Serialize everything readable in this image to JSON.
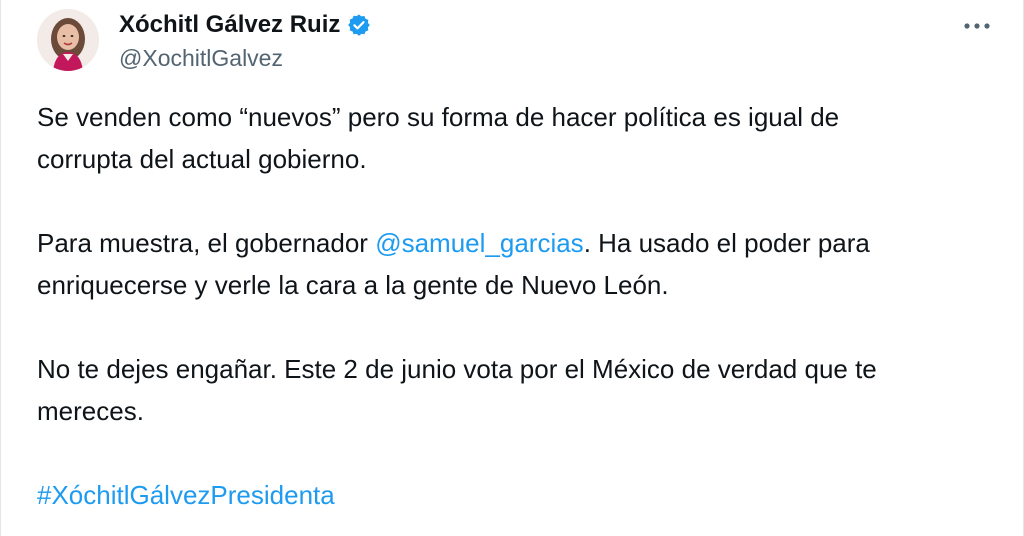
{
  "author": {
    "display_name": "Xóchitl Gálvez Ruiz",
    "handle": "@XochitlGalvez",
    "avatar_icon": "profile-photo",
    "verified_icon": "verified-badge-icon",
    "verified_color": "#1d9bf0"
  },
  "menu": {
    "icon": "more-options-icon"
  },
  "tweet": {
    "paragraph1": {
      "line1": "Se venden como “nuevos” pero su forma de hacer política es igual de",
      "line2": "corrupta del actual gobierno."
    },
    "paragraph2": {
      "line1_before": "Para muestra, el gobernador ",
      "mention": "@samuel_garcias",
      "line1_after": ". Ha usado el poder para",
      "line2": "enriquecerse y verle la cara a la gente de Nuevo León."
    },
    "paragraph3": {
      "line1": "No te dejes engañar. Este 2 de junio vota por el México de verdad que te",
      "line2": "mereces."
    },
    "hashtag": "#XóchitlGálvezPresidenta"
  },
  "colors": {
    "text": "#0f1419",
    "secondary": "#536471",
    "link": "#1d9bf0"
  }
}
